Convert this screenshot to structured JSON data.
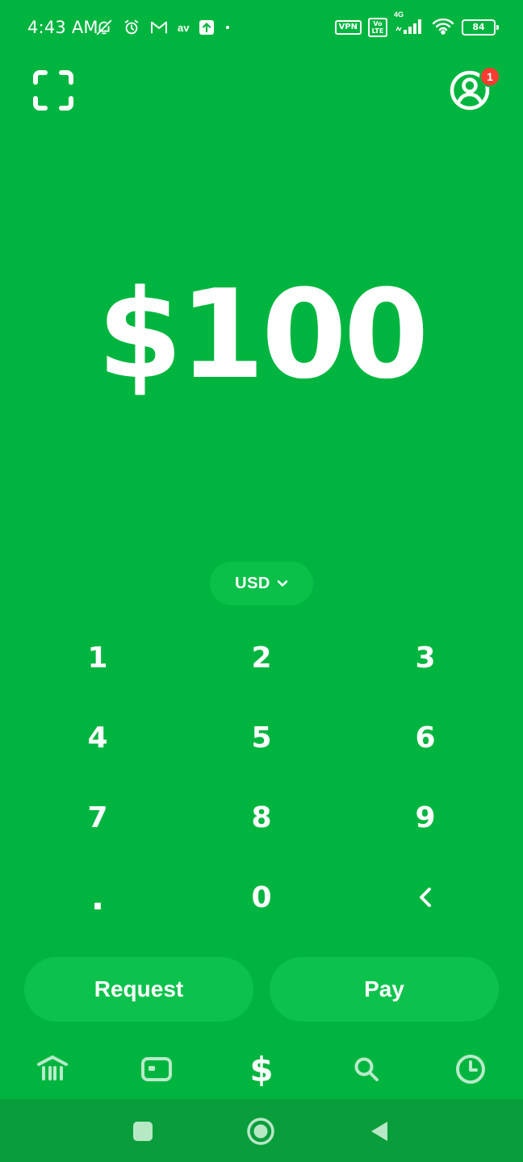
{
  "status_bar": {
    "time": "4:43 AM",
    "left_icons": [
      "muted-bell-icon",
      "alarm-icon",
      "gmail-icon",
      "app-icon",
      "upload-icon",
      "dot-icon"
    ],
    "left_text_icon": "av",
    "vpn_label": "VPN",
    "volte_label": "Vo LTE",
    "network_label": "4G",
    "battery_level": "84"
  },
  "header": {
    "scan_icon": "scan-icon",
    "profile_icon": "profile-icon",
    "profile_badge_count": "1"
  },
  "amount": {
    "value": "$100"
  },
  "currency": {
    "selected": "USD"
  },
  "keypad": {
    "keys": [
      "1",
      "2",
      "3",
      "4",
      "5",
      "6",
      "7",
      "8",
      "9",
      ".",
      "0",
      "<"
    ]
  },
  "actions": {
    "request_label": "Request",
    "pay_label": "Pay"
  },
  "bottom_nav": {
    "items": [
      "bank-icon",
      "card-icon",
      "dollar-icon",
      "search-icon",
      "activity-clock-icon"
    ],
    "dollar_symbol": "$",
    "active": "dollar-icon"
  },
  "system_nav": {
    "buttons": [
      "recents-icon",
      "home-icon",
      "back-icon"
    ]
  },
  "colors": {
    "background": "#00b53f",
    "button_fill": "#0cc24c",
    "badge": "#ff3b30",
    "system_nav": "#0a9d3b"
  }
}
